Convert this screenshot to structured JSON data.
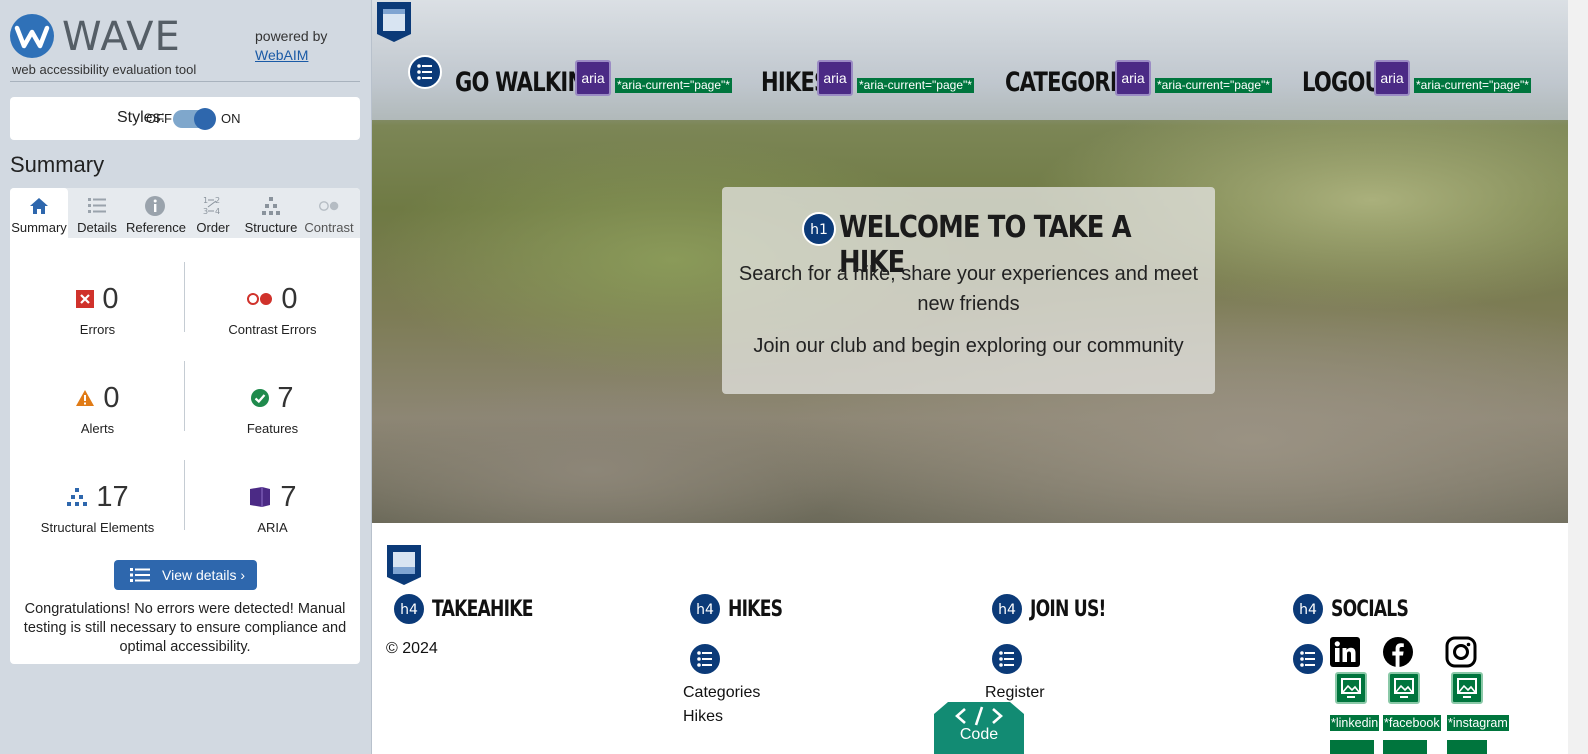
{
  "wave": {
    "brand": "WAVE",
    "subtitle": "web accessibility evaluation tool",
    "powered_by": "powered by",
    "webaim_link": "WebAIM",
    "styles_label": "Styles:",
    "styles_off": "OFF",
    "styles_on": "ON",
    "styles_enabled": true,
    "section_title": "Summary",
    "tabs": [
      {
        "label": "Summary",
        "icon": "home-icon",
        "active": true
      },
      {
        "label": "Details",
        "icon": "list-icon",
        "active": false
      },
      {
        "label": "Reference",
        "icon": "info-icon",
        "active": false
      },
      {
        "label": "Order",
        "icon": "order-icon",
        "active": false
      },
      {
        "label": "Structure",
        "icon": "structure-icon",
        "active": false
      },
      {
        "label": "Contrast",
        "icon": "contrast-icon",
        "active": false
      }
    ],
    "stats": {
      "errors": {
        "value": "0",
        "label": "Errors"
      },
      "contrast_errors": {
        "value": "0",
        "label": "Contrast Errors"
      },
      "alerts": {
        "value": "0",
        "label": "Alerts"
      },
      "features": {
        "value": "7",
        "label": "Features"
      },
      "structural": {
        "value": "17",
        "label": "Structural Elements"
      },
      "aria": {
        "value": "7",
        "label": "ARIA"
      }
    },
    "view_details": "View details ›",
    "congrats": "Congratulations! No errors were detected! Manual testing is still necessary to ensure compliance and optimal accessibility.",
    "colors": {
      "accent": "#2e67ad",
      "error": "#d0322b",
      "alert": "#e07b16",
      "feature": "#1f8a4c",
      "aria": "#4b2a85",
      "sidebar": "#d2d9e1"
    }
  },
  "site": {
    "nav": [
      {
        "label": "GO WALKING!",
        "aria": "aria",
        "aria_current": "*aria-current=\"page\"*"
      },
      {
        "label": "HIKES",
        "aria": "aria",
        "aria_current": "*aria-current=\"page\"*"
      },
      {
        "label": "CATEGORIES",
        "aria": "aria",
        "aria_current": "*aria-current=\"page\"*"
      },
      {
        "label": "LOGOUT",
        "aria": "aria",
        "aria_current": "*aria-current=\"page\"*"
      }
    ],
    "hero": {
      "heading_badge": "h1",
      "title": "WELCOME TO TAKE A HIKE",
      "text1": "Search for a hike, share your experiences and meet new friends",
      "text2": "Join our club and begin exploring our community"
    },
    "footer": {
      "badge": "h4",
      "cols": [
        {
          "title": "TAKEAHIKE",
          "text": "© 2024"
        },
        {
          "title": "HIKES",
          "links": [
            "Categories",
            "Hikes"
          ]
        },
        {
          "title": "JOIN US!",
          "links": [
            "Register"
          ]
        },
        {
          "title": "SOCIALS"
        }
      ],
      "socials": [
        {
          "icon": "linkedin-icon",
          "alt": "*linkedin"
        },
        {
          "icon": "facebook-icon",
          "alt": "*facebook"
        },
        {
          "icon": "instagram-icon",
          "alt": "*instagram"
        }
      ]
    },
    "code_button": "Code"
  }
}
